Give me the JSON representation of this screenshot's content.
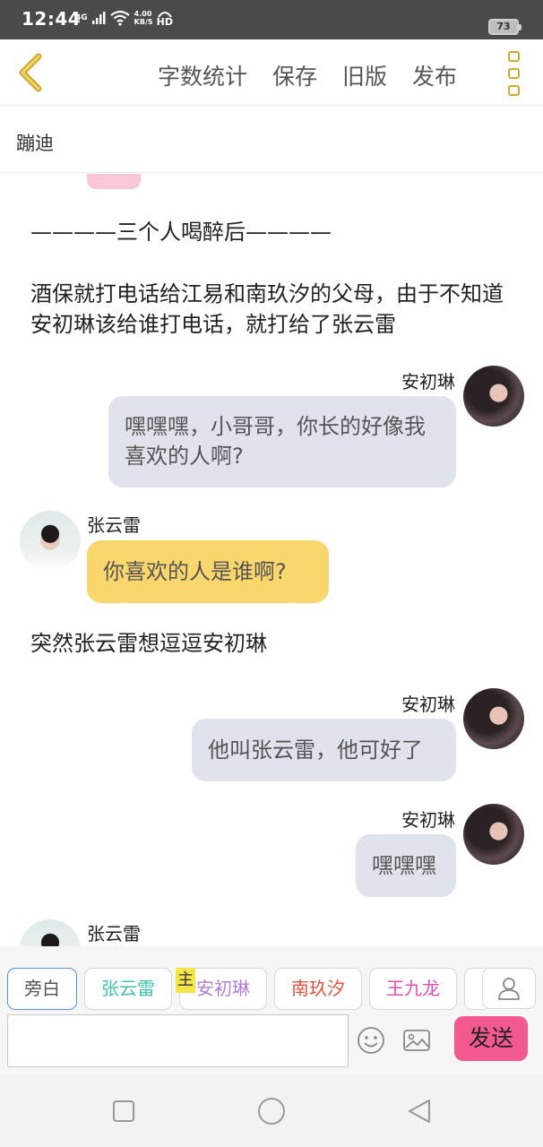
{
  "status_bar": {
    "time": "12:44",
    "network": "4G",
    "speed_value": "4.00",
    "speed_unit": "KB/S",
    "hd": "HD",
    "battery": "73"
  },
  "toolbar": {
    "back_icon": "chevron-left-icon",
    "links": [
      "字数统计",
      "保存",
      "旧版",
      "发布"
    ],
    "more_icon": "more-vertical-icon",
    "accent_color": "#cfa92c"
  },
  "story": {
    "title": "蹦迪"
  },
  "messages": [
    {
      "type": "narration",
      "text": "————三个人喝醉后————"
    },
    {
      "type": "narration",
      "text": "酒保就打电话给江易和南玖汐的父母，由于不知道安初琳该给谁打电话，就打给了张云雷"
    },
    {
      "type": "right",
      "speaker": "安初琳",
      "text": "嘿嘿嘿，小哥哥，你长的好像我喜欢的人啊?"
    },
    {
      "type": "left",
      "speaker": "张云雷",
      "text": "你喜欢的人是谁啊?"
    },
    {
      "type": "narration",
      "text": "突然张云雷想逗逗安初琳"
    },
    {
      "type": "right",
      "speaker": "安初琳",
      "text": "他叫张云雷，他可好了"
    },
    {
      "type": "right",
      "speaker": "安初琳",
      "text": "嘿嘿嘿"
    },
    {
      "type": "left",
      "speaker": "张云雷",
      "text": ""
    }
  ],
  "roles": [
    {
      "name": "旁白",
      "color": "#555555",
      "selected": true
    },
    {
      "name": "张云雷",
      "color": "#3fbfae"
    },
    {
      "name": "安初琳",
      "color": "#b07fd8",
      "badge": "主"
    },
    {
      "name": "南玖汐",
      "color": "#e0533c"
    },
    {
      "name": "王九龙",
      "color": "#e04fb1"
    }
  ],
  "composer": {
    "placeholder": "",
    "send_label": "发送",
    "send_color": "#f1598f",
    "emoji_icon": "emoji-icon",
    "image_icon": "image-icon",
    "user_icon": "user-icon"
  },
  "nav": {
    "recent_icon": "square-icon",
    "home_icon": "circle-icon",
    "back_icon": "triangle-back-icon"
  }
}
